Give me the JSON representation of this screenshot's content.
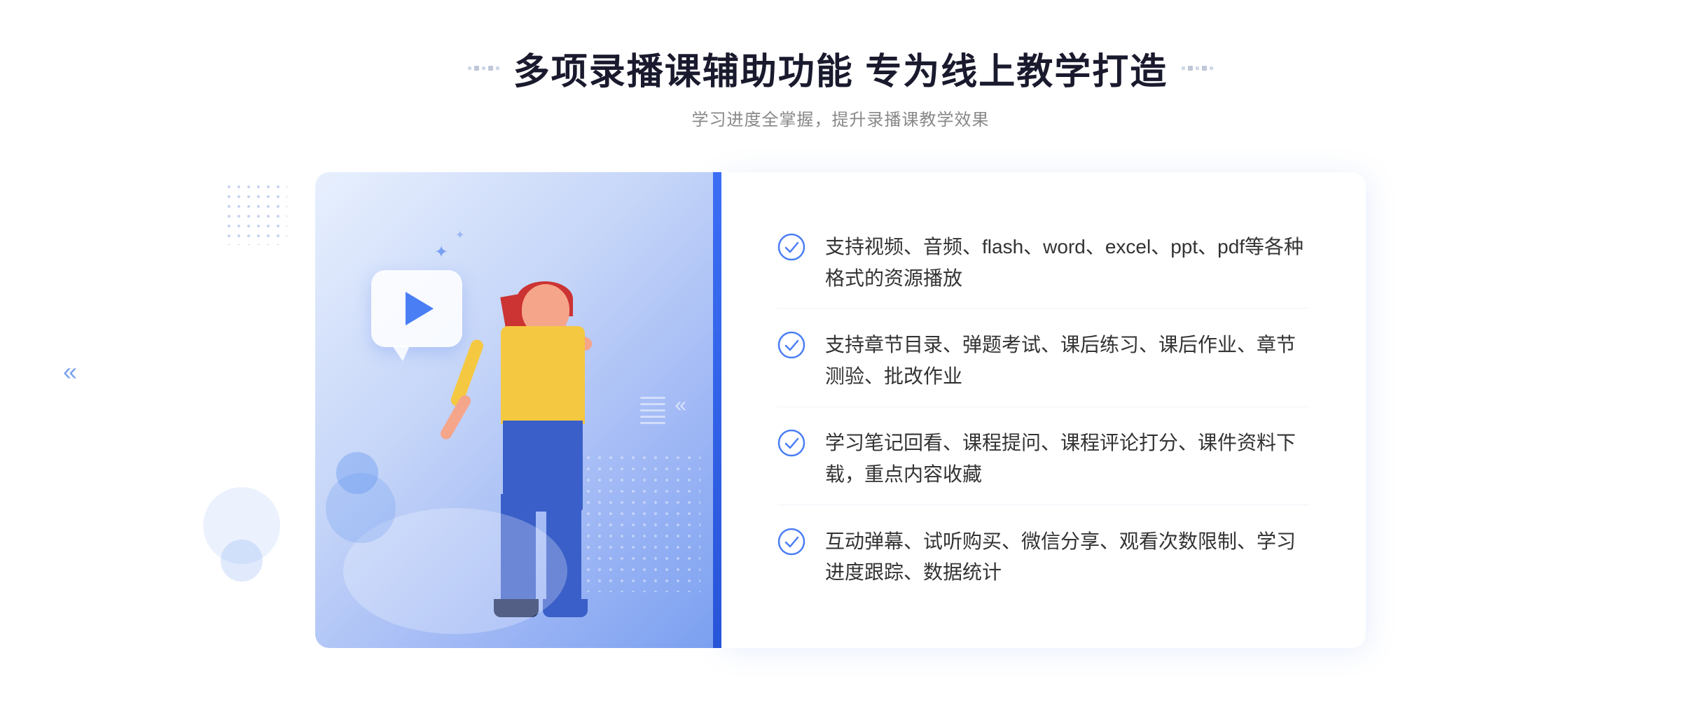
{
  "header": {
    "title": "多项录播课辅助功能 专为线上教学打造",
    "subtitle": "学习进度全掌握，提升录播课教学效果"
  },
  "features": [
    {
      "id": 1,
      "text": "支持视频、音频、flash、word、excel、ppt、pdf等各种格式的资源播放"
    },
    {
      "id": 2,
      "text": "支持章节目录、弹题考试、课后练习、课后作业、章节测验、批改作业"
    },
    {
      "id": 3,
      "text": "学习笔记回看、课程提问、课程评论打分、课件资料下载，重点内容收藏"
    },
    {
      "id": 4,
      "text": "互动弹幕、试听购买、微信分享、观看次数限制、学习进度跟踪、数据统计"
    }
  ],
  "colors": {
    "accent_blue": "#4a7ef5",
    "title_dark": "#1a1a2e",
    "text_gray": "#888888",
    "feature_text": "#333333",
    "check_color": "#4a7ef5"
  },
  "icons": {
    "check_circle": "check-circle-icon",
    "play": "play-icon",
    "chevron": "chevron-icon"
  }
}
